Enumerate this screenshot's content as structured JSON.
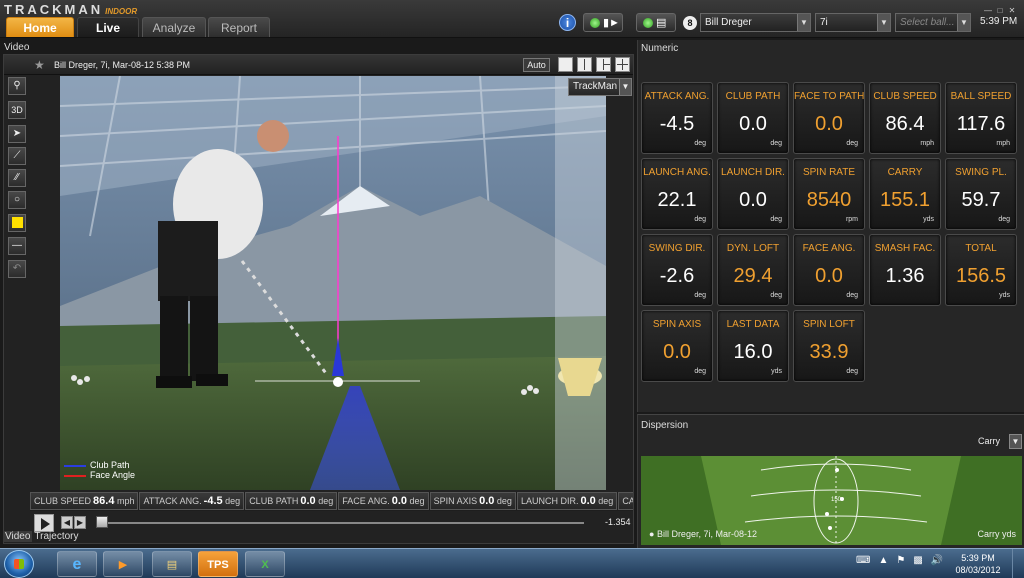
{
  "app": {
    "logo": "TRACKMAN",
    "logo_sub": "INDOOR",
    "clock": "5:39 PM"
  },
  "tabs": [
    {
      "label": "Home"
    },
    {
      "label": "Live"
    },
    {
      "label": "Analyze"
    },
    {
      "label": "Report"
    }
  ],
  "toolbar": {
    "device_count": "8",
    "player": "Bill Dreger",
    "club": "7i",
    "ball_placeholder": "Select ball..."
  },
  "video": {
    "section_label": "Video",
    "title": "Bill Dreger, 7i, Mar-08-12 5:38 PM",
    "auto_label": "Auto",
    "source": "TrackMan",
    "legend": [
      "Club Path",
      "Face Angle"
    ],
    "readouts": [
      {
        "label": "CLUB SPEED",
        "value": "86.4",
        "unit": "mph"
      },
      {
        "label": "ATTACK ANG.",
        "value": "-4.5",
        "unit": "deg"
      },
      {
        "label": "CLUB PATH",
        "value": "0.0",
        "unit": "deg"
      },
      {
        "label": "FACE ANG.",
        "value": "0.0",
        "unit": "deg"
      },
      {
        "label": "SPIN AXIS",
        "value": "0.0",
        "unit": "deg"
      },
      {
        "label": "LAUNCH DIR.",
        "value": "0.0",
        "unit": "deg"
      },
      {
        "label": "CARRY",
        "value": "",
        "unit": ""
      }
    ],
    "time": "-1.354",
    "bottom_tabs": [
      "Video",
      "Trajectory"
    ]
  },
  "numeric": {
    "section_label": "Numeric",
    "tiles": [
      {
        "label": "ATTACK ANG.",
        "value": "-4.5",
        "unit": "deg",
        "color": "#ffffff"
      },
      {
        "label": "CLUB PATH",
        "value": "0.0",
        "unit": "deg",
        "color": "#ffffff"
      },
      {
        "label": "FACE TO PATH",
        "value": "0.0",
        "unit": "deg",
        "color": "#f0a030"
      },
      {
        "label": "CLUB SPEED",
        "value": "86.4",
        "unit": "mph",
        "color": "#ffffff"
      },
      {
        "label": "BALL SPEED",
        "value": "117.6",
        "unit": "mph",
        "color": "#ffffff"
      },
      {
        "label": "LAUNCH ANG.",
        "value": "22.1",
        "unit": "deg",
        "color": "#ffffff"
      },
      {
        "label": "LAUNCH DIR.",
        "value": "0.0",
        "unit": "deg",
        "color": "#ffffff"
      },
      {
        "label": "SPIN RATE",
        "value": "8540",
        "unit": "rpm",
        "color": "#f0a030"
      },
      {
        "label": "CARRY",
        "value": "155.1",
        "unit": "yds",
        "color": "#f0a030"
      },
      {
        "label": "SWING PL.",
        "value": "59.7",
        "unit": "deg",
        "color": "#ffffff"
      },
      {
        "label": "SWING DIR.",
        "value": "-2.6",
        "unit": "deg",
        "color": "#ffffff"
      },
      {
        "label": "DYN. LOFT",
        "value": "29.4",
        "unit": "deg",
        "color": "#f0a030"
      },
      {
        "label": "FACE ANG.",
        "value": "0.0",
        "unit": "deg",
        "color": "#f0a030"
      },
      {
        "label": "SMASH FAC.",
        "value": "1.36",
        "unit": "",
        "color": "#ffffff"
      },
      {
        "label": "TOTAL",
        "value": "156.5",
        "unit": "yds",
        "color": "#f0a030"
      },
      {
        "label": "SPIN AXIS",
        "value": "0.0",
        "unit": "deg",
        "color": "#f0a030"
      },
      {
        "label": "LAST DATA",
        "value": "16.0",
        "unit": "yds",
        "color": "#ffffff"
      },
      {
        "label": "SPIN LOFT",
        "value": "33.9",
        "unit": "deg",
        "color": "#f0a030"
      }
    ]
  },
  "dispersion": {
    "section_label": "Dispersion",
    "mode": "Carry",
    "caption": "Bill Dreger, 7i, Mar-08-12",
    "unit_label": "Carry yds",
    "distance_marker": "150"
  },
  "taskbar": {
    "apps": [
      "IE",
      "WMP",
      "Explorer",
      "TPS",
      "Excel"
    ],
    "time": "5:39 PM",
    "date": "08/03/2012"
  }
}
